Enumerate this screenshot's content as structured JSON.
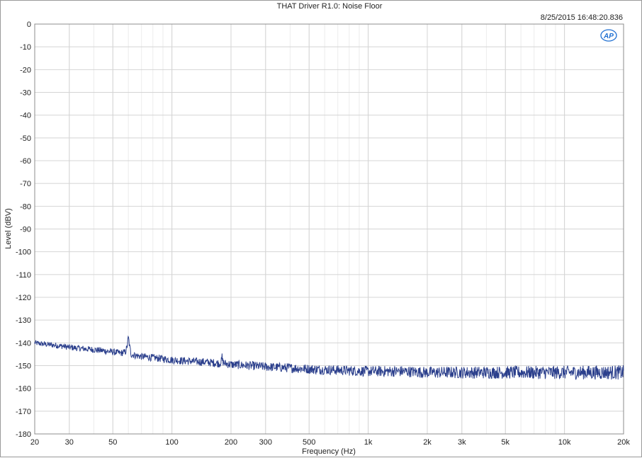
{
  "chart_data": {
    "type": "line",
    "title": "THAT Driver R1.0: Noise Floor",
    "timestamp": "8/25/2015 16:48:20.836",
    "logo": "AP",
    "xlabel": "Frequency (Hz)",
    "ylabel": "Level (dBV)",
    "xscale": "log",
    "xlim": [
      20,
      20000
    ],
    "ylim": [
      -180,
      0
    ],
    "grid": true,
    "x_ticks": [
      20,
      30,
      50,
      100,
      200,
      300,
      500,
      1000,
      2000,
      3000,
      5000,
      10000,
      20000
    ],
    "x_tick_labels": [
      "20",
      "30",
      "50",
      "100",
      "200",
      "300",
      "500",
      "1k",
      "2k",
      "3k",
      "5k",
      "10k",
      "20k"
    ],
    "y_ticks": [
      0,
      -10,
      -20,
      -30,
      -40,
      -50,
      -60,
      -70,
      -80,
      -90,
      -100,
      -110,
      -120,
      -130,
      -140,
      -150,
      -160,
      -170,
      -180
    ],
    "y_tick_labels": [
      "0",
      "-10",
      "-20",
      "-30",
      "-40",
      "-50",
      "-60",
      "-70",
      "-80",
      "-90",
      "-100",
      "-110",
      "-120",
      "-130",
      "-140",
      "-150",
      "-160",
      "-170",
      "-180"
    ],
    "series": [
      {
        "color": "#2b3f8c",
        "x": [
          20,
          22,
          25,
          28,
          30,
          35,
          40,
          45,
          50,
          55,
          58,
          59,
          60,
          61,
          62,
          65,
          70,
          80,
          90,
          100,
          120,
          150,
          175,
          179,
          180,
          181,
          185,
          200,
          250,
          300,
          400,
          500,
          700,
          1000,
          1500,
          2000,
          3000,
          5000,
          7000,
          10000,
          15000,
          20000
        ],
        "y": [
          -140,
          -140.5,
          -141,
          -141.5,
          -142,
          -142.5,
          -143,
          -143.5,
          -144,
          -144.5,
          -144,
          -142,
          -137.5,
          -142,
          -145,
          -145.5,
          -146,
          -146.5,
          -147,
          -147.5,
          -148,
          -148.5,
          -149,
          -148,
          -146,
          -148,
          -149,
          -149.5,
          -150,
          -150.5,
          -151,
          -151.5,
          -152,
          -152.5,
          -152.5,
          -153,
          -153,
          -153,
          -153,
          -153,
          -153,
          -153
        ]
      }
    ]
  }
}
